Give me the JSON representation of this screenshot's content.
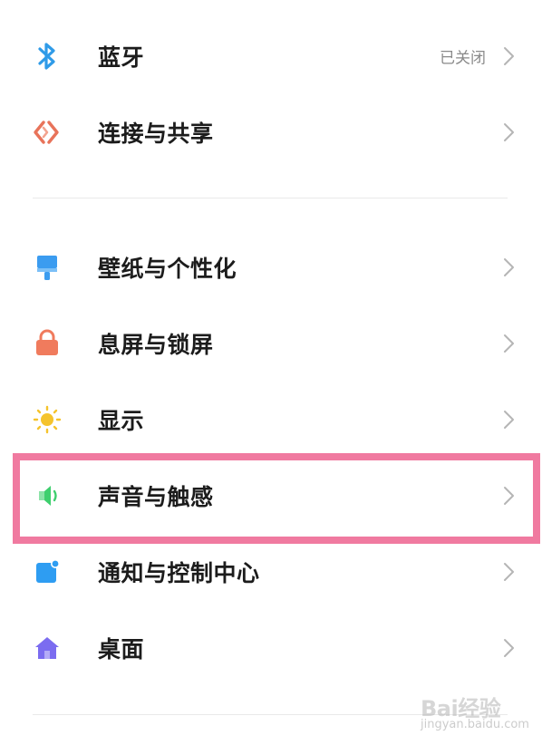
{
  "settings": {
    "items": [
      {
        "label": "蓝牙",
        "status": "已关闭",
        "icon": "bluetooth-icon",
        "color": "#2f9be8"
      },
      {
        "label": "连接与共享",
        "status": "",
        "icon": "connection-share-icon",
        "color": "#e8735a"
      },
      {
        "label": "壁纸与个性化",
        "status": "",
        "icon": "wallpaper-brush-icon",
        "color": "#3b9cf0"
      },
      {
        "label": "息屏与锁屏",
        "status": "",
        "icon": "lock-icon",
        "color": "#f07b5d"
      },
      {
        "label": "显示",
        "status": "",
        "icon": "sun-icon",
        "color": "#f5c32c"
      },
      {
        "label": "声音与触感",
        "status": "",
        "icon": "speaker-icon",
        "color": "#3ecf6e"
      },
      {
        "label": "通知与控制中心",
        "status": "",
        "icon": "notification-icon",
        "color": "#2e9df2"
      },
      {
        "label": "桌面",
        "status": "",
        "icon": "home-icon",
        "color": "#7b6cf0"
      }
    ]
  },
  "highlight_color": "#f07aa0",
  "watermark": {
    "text": "Bai经验",
    "sub": "jingyan.baidu.com"
  }
}
